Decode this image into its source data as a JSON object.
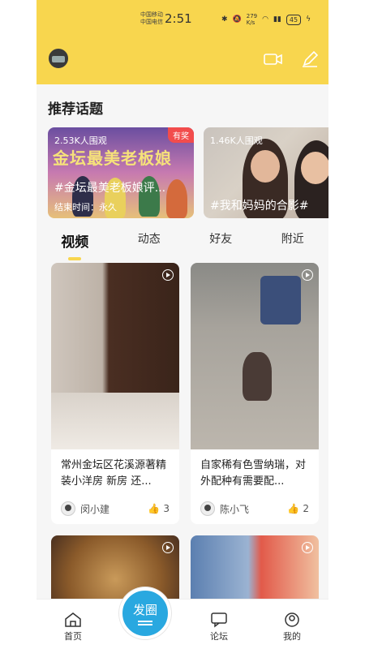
{
  "status_bar": {
    "carrier_1": "中国移动",
    "carrier_2": "中国电信",
    "time": "2:51",
    "net_speed": "279",
    "net_unit": "K/s",
    "battery": "45"
  },
  "section": {
    "title": "推荐话题"
  },
  "topics": [
    {
      "views": "2.53K人围观",
      "name": "#金坛最美老板娘评...",
      "end": "结束时间：永久",
      "badge": "有奖",
      "banner": "金坛最美老板娘"
    },
    {
      "views": "1.46K人围观",
      "name": "#我和妈妈的合影#"
    }
  ],
  "tabs": [
    {
      "label": "视频",
      "active": true
    },
    {
      "label": "动态"
    },
    {
      "label": "好友"
    },
    {
      "label": "附近"
    }
  ],
  "videos": [
    {
      "title": "常州金坛区花溪源著精装小洋房 新房 还...",
      "user": "闵小建",
      "likes": "3"
    },
    {
      "title": "自家稀有色雪纳瑞，对外配种有需要配...",
      "user": "陈小飞",
      "likes": "2"
    }
  ],
  "nav": {
    "home": "首页",
    "post": "发圈",
    "forum": "论坛",
    "mine": "我的"
  },
  "colors": {
    "accent_yellow": "#f8d64e",
    "fab_blue": "#29a8e0",
    "badge_red": "#f24c4c"
  }
}
